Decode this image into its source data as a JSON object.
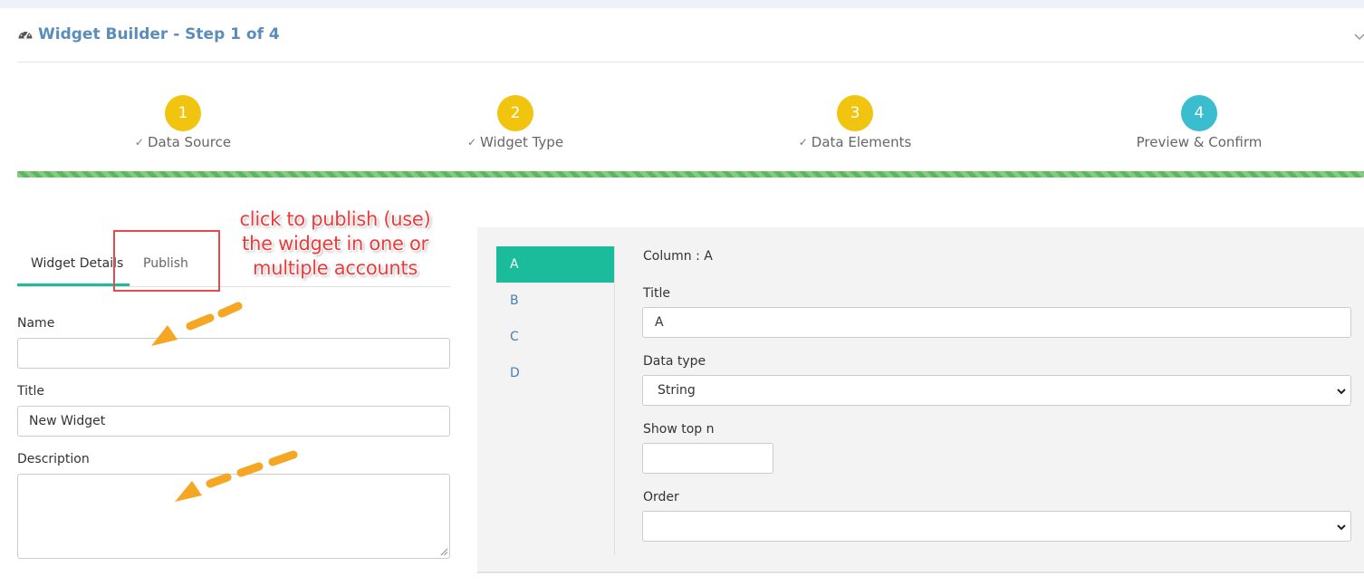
{
  "header": {
    "title": "Widget Builder - Step 1 of 4",
    "icon": "dashboard-gauge-icon",
    "collapse_icon": "chevron-down-icon",
    "title_color": "#5b8dbb"
  },
  "wizard": {
    "steps": [
      {
        "number": "1",
        "label": "Data Source",
        "status": "done",
        "check_icon": "check-icon"
      },
      {
        "number": "2",
        "label": "Widget Type",
        "status": "done",
        "check_icon": "check-icon"
      },
      {
        "number": "3",
        "label": "Data Elements",
        "status": "done",
        "check_icon": "check-icon"
      },
      {
        "number": "4",
        "label": "Preview & Confirm",
        "status": "current"
      }
    ],
    "progress_percent": 100,
    "done_color": "#f1c40f",
    "current_color": "#3bbdd0",
    "progress_color": "#5cb85c"
  },
  "tabs": [
    {
      "label": "Widget Details",
      "active": true
    },
    {
      "label": "Publish",
      "active": false
    }
  ],
  "details_form": {
    "name_label": "Name",
    "name_value": "",
    "title_label": "Title",
    "title_value": "New Widget",
    "description_label": "Description",
    "description_value": ""
  },
  "columns": {
    "items": [
      "A",
      "B",
      "C",
      "D"
    ],
    "selected": "A",
    "accent_color": "#1abc9c"
  },
  "column_form": {
    "header": "Column : A",
    "title_label": "Title",
    "title_value": "A",
    "data_type_label": "Data type",
    "data_type_value": "String",
    "show_top_label": "Show top n",
    "show_top_value": "",
    "order_label": "Order",
    "order_value": ""
  },
  "annotation": {
    "lines": [
      "click to publish (use)",
      "the widget in one or",
      "multiple accounts"
    ],
    "text_color": "#ee3a3a",
    "arrow_color": "#f5a623"
  }
}
